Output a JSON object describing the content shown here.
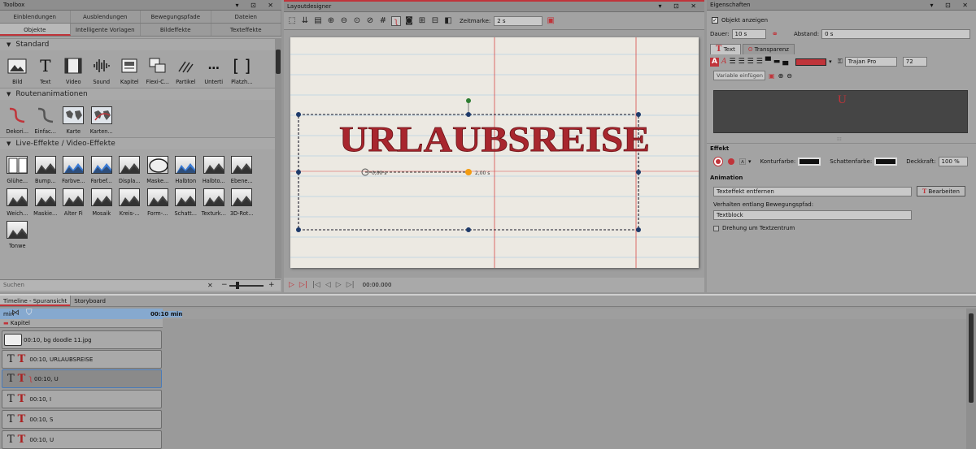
{
  "toolbox": {
    "title": "Toolbox",
    "tabs_top": [
      "Einblendungen",
      "Ausblendungen",
      "Bewegungspfade",
      "Dateien"
    ],
    "tabs_bottom": [
      "Objekte",
      "Intelligente Vorlagen",
      "Bildeffekte",
      "Texteffekte"
    ],
    "sections": [
      {
        "title": "Standard",
        "items": [
          {
            "label": "Bild",
            "icon": "image-icon"
          },
          {
            "label": "Text",
            "icon": "text-icon"
          },
          {
            "label": "Video",
            "icon": "video-icon"
          },
          {
            "label": "Sound",
            "icon": "sound-icon"
          },
          {
            "label": "Kapitel",
            "icon": "chapter-icon"
          },
          {
            "label": "Flexi-C...",
            "icon": "flexi-collage-icon"
          },
          {
            "label": "Partikel",
            "icon": "particle-icon"
          },
          {
            "label": "Unterti",
            "icon": "subtitle-icon"
          },
          {
            "label": "Platzh...",
            "icon": "placeholder-icon"
          }
        ]
      },
      {
        "title": "Routenanimationen",
        "items": [
          {
            "label": "Dekori...",
            "icon": "route-red-icon"
          },
          {
            "label": "Einfac...",
            "icon": "route-gray-icon"
          },
          {
            "label": "Karte",
            "icon": "map-icon"
          },
          {
            "label": "Karten...",
            "icon": "map-route-icon"
          }
        ]
      },
      {
        "title": "Live-Effekte / Video-Effekte",
        "items": [
          {
            "label": "Glühe...",
            "icon": "glow-icon"
          },
          {
            "label": "Bump...",
            "icon": "bump-icon"
          },
          {
            "label": "Farbve...",
            "icon": "color-gradient-icon"
          },
          {
            "label": "Farbef...",
            "icon": "color-effect-icon"
          },
          {
            "label": "Displa...",
            "icon": "displace-icon"
          },
          {
            "label": "Maske...",
            "icon": "mask-icon"
          },
          {
            "label": "Halbton",
            "icon": "halftone-icon"
          },
          {
            "label": "Halbto...",
            "icon": "halftone2-icon"
          },
          {
            "label": "Ebene...",
            "icon": "layer-icon"
          },
          {
            "label": "Weich...",
            "icon": "soften-icon"
          },
          {
            "label": "Maskie...",
            "icon": "masking-icon"
          },
          {
            "label": "Alter Fi",
            "icon": "old-film-icon"
          },
          {
            "label": "Mosaik",
            "icon": "mosaic-icon"
          },
          {
            "label": "Kreis-...",
            "icon": "circle-icon"
          },
          {
            "label": "Form-...",
            "icon": "shape-icon"
          },
          {
            "label": "Schatt...",
            "icon": "shadow-icon"
          },
          {
            "label": "Texturk...",
            "icon": "texture-icon"
          },
          {
            "label": "3D-Rot...",
            "icon": "rotate3d-icon"
          },
          {
            "label": "Tonwe",
            "icon": "tone-icon"
          }
        ]
      }
    ],
    "search_placeholder": "Suchen"
  },
  "layout": {
    "title": "Layoutdesigner",
    "zeitmarke_label": "Zeitmarke:",
    "zeitmarke_value": "2 s",
    "canvas_text": "URLAUBSREISE",
    "timecode": "00:00.000",
    "path_label_a": "0,00 s",
    "path_label_b": "2,00 s"
  },
  "props": {
    "title": "Eigenschaften",
    "show_object": "Objekt anzeigen",
    "dauer_label": "Dauer:",
    "dauer_value": "10 s",
    "abstand_label": "Abstand:",
    "abstand_value": "0 s",
    "tab_text": "Text",
    "tab_transparency": "Transparenz",
    "font": "Trajan Pro",
    "size": "72",
    "variable": "Variable einfügen",
    "preview_char": "U",
    "effekt_head": "Effekt",
    "kontur_label": "Konturfarbe:",
    "schatten_label": "Schattenfarbe:",
    "deckkraft_label": "Deckkraft:",
    "deckkraft_value": "100 %",
    "animation_head": "Animation",
    "text_effect": "Texteffekt entfernen",
    "edit_button": "Bearbeiten",
    "path_behaviour_label": "Verhalten entlang Bewegungspfad:",
    "path_behaviour_value": "Textblock",
    "rotate_label": "Drehung um Textzentrum",
    "text_color": "#c0343a"
  },
  "timeline": {
    "tab_spur": "Timeline - Spuransicht",
    "tab_story": "Storyboard",
    "ruler_label": "00:10 min",
    "ruler_left": "min",
    "chapter": "Kapitel",
    "tracks": [
      {
        "label": "00:10, bg doodle 11.jpg",
        "type": "image"
      },
      {
        "label": "00:10, URLAUBSREISE",
        "type": "text"
      },
      {
        "label": "00:10, U",
        "type": "text-path"
      },
      {
        "label": "00:10, I",
        "type": "text"
      },
      {
        "label": "00:10, S",
        "type": "text"
      },
      {
        "label": "00:10, U",
        "type": "text"
      }
    ]
  }
}
